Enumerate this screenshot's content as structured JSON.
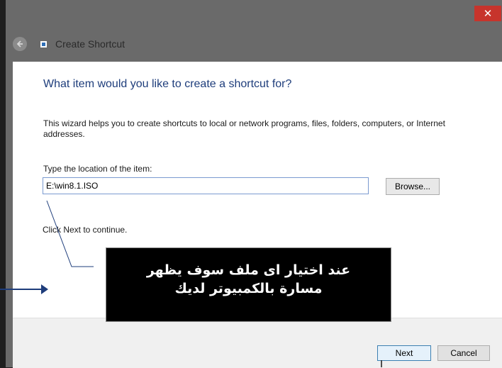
{
  "window": {
    "title": "Create Shortcut",
    "close_glyph": "✕"
  },
  "wizard": {
    "heading": "What item would you like to create a shortcut for?",
    "description": "This wizard helps you to create shortcuts to local or network programs, files, folders, computers, or Internet addresses.",
    "location_label": "Type the location of the item:",
    "location_value": "E:\\win8.1.ISO",
    "browse_label": "Browse...",
    "next_hint": "Click Next to continue."
  },
  "footer": {
    "next_label": "Next",
    "cancel_label": "Cancel"
  },
  "annotation": {
    "text": "عند اختيار اى ملف سوف يظهر مسارة بالكمبيوتر لديك"
  },
  "icons": {
    "back": "back-arrow-icon",
    "shortcut": "shortcut-icon",
    "close": "close-icon"
  },
  "colors": {
    "heading": "#1e3d7b",
    "close_button": "#c7342c",
    "callout_bg": "#000000"
  }
}
